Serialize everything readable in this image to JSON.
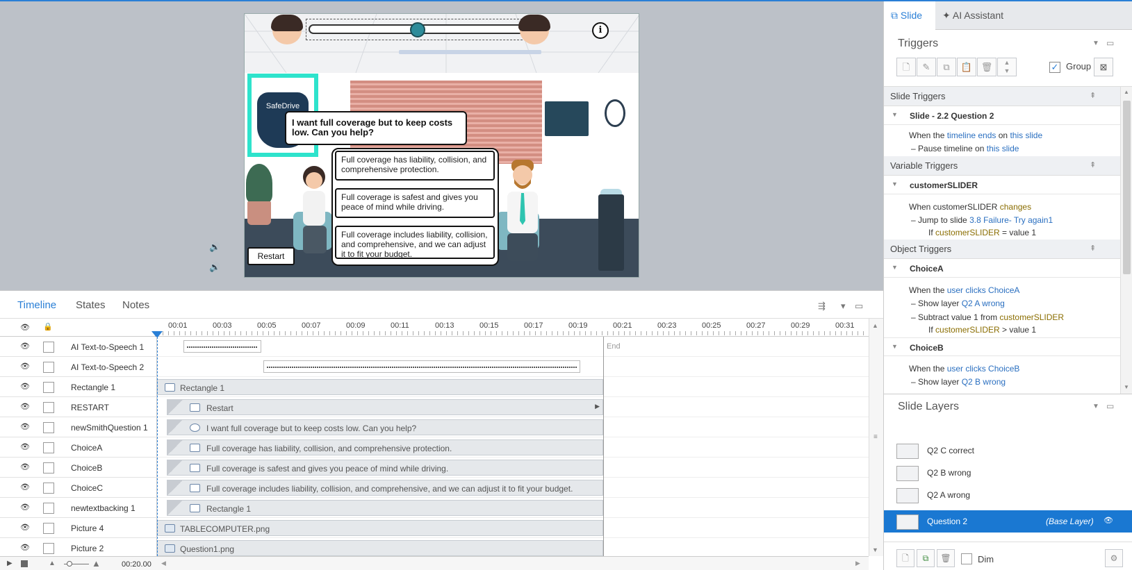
{
  "slide": {
    "logo_text": "SafeDrive",
    "question": "I want full coverage but to keep costs low. Can you help?",
    "choices": [
      "Full coverage has liability, collision, and comprehensive protection.",
      "Full coverage is safest and gives you peace of mind while driving.",
      "Full coverage includes liability, collision, and comprehensive, and we can adjust it to fit your budget."
    ],
    "restart": "Restart",
    "info": "i",
    "slider_value": 0.5
  },
  "timeline": {
    "tabs": [
      "Timeline",
      "States",
      "Notes"
    ],
    "ticks": [
      "00:01",
      "00:03",
      "00:05",
      "00:07",
      "00:09",
      "00:11",
      "00:13",
      "00:15",
      "00:17",
      "00:19",
      "00:21",
      "00:23",
      "00:25",
      "00:27",
      "00:29",
      "00:31"
    ],
    "end_label": "End",
    "duration": "00:20.00",
    "rows": [
      {
        "name": "AI Text-to-Speech 1",
        "label": ""
      },
      {
        "name": "AI Text-to-Speech 2",
        "label": ""
      },
      {
        "name": "Rectangle 1",
        "label": "Rectangle 1"
      },
      {
        "name": "RESTART",
        "label": "Restart"
      },
      {
        "name": "newSmithQuestion 1",
        "label": "I want full coverage but to keep costs low. Can you help?"
      },
      {
        "name": "ChoiceA",
        "label": "Full coverage has liability, collision, and comprehensive protection."
      },
      {
        "name": "ChoiceB",
        "label": "Full coverage is safest and gives you peace of mind while driving."
      },
      {
        "name": "ChoiceC",
        "label": "Full coverage includes liability, collision, and comprehensive, and we can adjust it to fit your budget."
      },
      {
        "name": "newtextbacking 1",
        "label": "Rectangle 1"
      },
      {
        "name": "Picture 4",
        "label": "TABLECOMPUTER.png"
      },
      {
        "name": "Picture 2",
        "label": "Question1.png"
      }
    ]
  },
  "panel": {
    "tabs": [
      "Slide",
      "AI Assistant"
    ],
    "triggers_title": "Triggers",
    "group_label": "Group",
    "slide_triggers_title": "Slide Triggers",
    "slide_group": "Slide - 2.2 Question 2",
    "variable_triggers_title": "Variable Triggers",
    "variable_group": "customerSLIDER",
    "object_triggers_title": "Object Triggers",
    "object_group_a": "ChoiceA",
    "object_group_b": "ChoiceB",
    "t1a": "When the ",
    "t1b": "timeline ends",
    "t1c": " on ",
    "t1d": "this slide",
    "t2a": "Pause timeline on ",
    "t2b": "this slide",
    "t3a": "When customerSLIDER ",
    "t3b": "changes",
    "t4a": "Jump to slide ",
    "t4b": "3.8 Failure- Try again1",
    "t5a": "If ",
    "t5b": "customerSLIDER",
    "t5c": " = value 1",
    "t6a": "When the ",
    "t6b": "user clicks",
    "t6c": " ChoiceA",
    "t7a": "Show layer ",
    "t7b": "Q2 A wrong",
    "t8a": "Subtract value 1 from ",
    "t8b": "customerSLIDER",
    "t9a": "If ",
    "t9b": "customerSLIDER",
    "t9c": " > value 1",
    "t10a": "When the ",
    "t10b": "user clicks",
    "t10c": " ChoiceB",
    "t11a": "Show layer ",
    "t11b": "Q2 B wrong",
    "layers_title": "Slide Layers",
    "layers": [
      "Q2 C correct",
      "Q2 B wrong",
      "Q2 A wrong"
    ],
    "base_layer": "Question 2",
    "base_layer_tag": "(Base Layer)",
    "dim_label": "Dim"
  }
}
